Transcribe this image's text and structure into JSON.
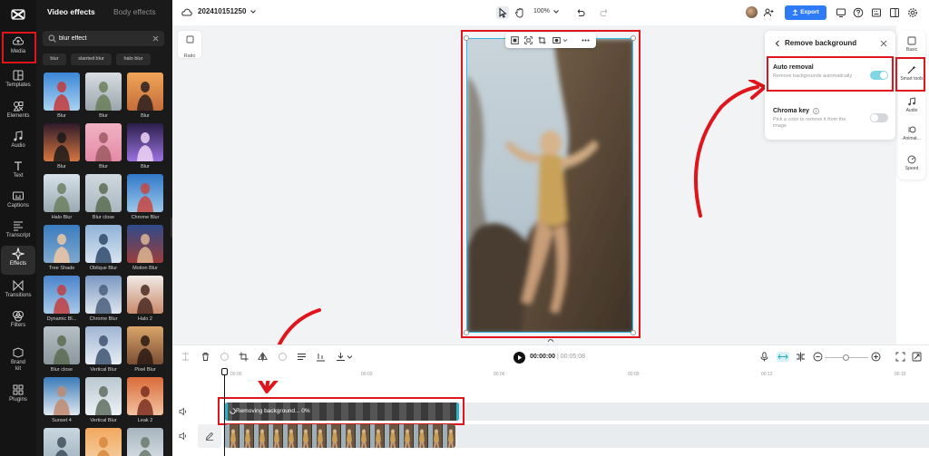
{
  "sidebar": {
    "items": [
      {
        "label": "Media",
        "icon": "cloud-upload-icon",
        "active": true
      },
      {
        "label": "Templates",
        "icon": "template-icon"
      },
      {
        "label": "Elements",
        "icon": "elements-icon"
      },
      {
        "label": "Audio",
        "icon": "music-note-icon"
      },
      {
        "label": "Text",
        "icon": "text-icon"
      },
      {
        "label": "Captions",
        "icon": "captions-icon"
      },
      {
        "label": "Transcript",
        "icon": "transcript-icon"
      },
      {
        "label": "Effects",
        "icon": "sparkle-icon",
        "active": true
      },
      {
        "label": "Transitions",
        "icon": "transitions-icon"
      },
      {
        "label": "Filters",
        "icon": "filters-icon"
      },
      {
        "label": "Brand kit",
        "icon": "brand-kit-icon"
      },
      {
        "label": "Plugins",
        "icon": "plugins-icon"
      }
    ]
  },
  "effects_panel": {
    "tabs": [
      "Video effects",
      "Body effects"
    ],
    "active_tab": "Video effects",
    "search": {
      "value": "blur effect",
      "placeholder": "Search"
    },
    "chips": [
      "blur",
      "slanted blur",
      "halo blur"
    ],
    "tiles": [
      {
        "label": "Blur"
      },
      {
        "label": "Blur"
      },
      {
        "label": "Blur"
      },
      {
        "label": "Blur"
      },
      {
        "label": "Blur"
      },
      {
        "label": "Blur"
      },
      {
        "label": "Halo Blur"
      },
      {
        "label": "Blur close"
      },
      {
        "label": "Chrome Blur"
      },
      {
        "label": "Tree Shade"
      },
      {
        "label": "Oblique Blur"
      },
      {
        "label": "Motion Blur"
      },
      {
        "label": "Dynamic Bl..."
      },
      {
        "label": "Chrome Blur"
      },
      {
        "label": "Halo 2"
      },
      {
        "label": "Blur close"
      },
      {
        "label": "Vertical Blur"
      },
      {
        "label": "Pixel Blur"
      },
      {
        "label": "Sunset 4"
      },
      {
        "label": "Vertical Blur"
      },
      {
        "label": "Leak 2"
      },
      {
        "label": ""
      },
      {
        "label": ""
      },
      {
        "label": ""
      }
    ]
  },
  "topbar": {
    "project_name": "202410151250",
    "zoom": "100%",
    "export_label": "Export"
  },
  "canvas": {
    "ratio_label": "Ratio"
  },
  "remove_bg": {
    "title": "Remove background",
    "auto": {
      "title": "Auto removal",
      "subtitle": "Remove backgrounds automatically",
      "enabled": true
    },
    "chroma": {
      "title": "Chroma key",
      "subtitle": "Pick a color to remove it from the image",
      "enabled": false
    }
  },
  "right_tools": [
    {
      "label": "Basic",
      "icon": "basic-icon"
    },
    {
      "label": "Smart tools",
      "icon": "magic-wand-icon"
    },
    {
      "label": "Audio",
      "icon": "audio-icon"
    },
    {
      "label": "Animat...",
      "icon": "animation-icon"
    },
    {
      "label": "Speed",
      "icon": "speed-icon"
    }
  ],
  "timeline": {
    "current_time": "00:00:00",
    "separator": "|",
    "total_time": "00:05:08",
    "ruler": [
      "00:00",
      "00:03",
      "00:06",
      "00:09",
      "00:12",
      "00:15"
    ],
    "clip_status": "Removing background... 0%"
  },
  "colors": {
    "accent_blue": "#2d7bf6",
    "highlight_red": "#e0141b",
    "toggle_on": "#6fd3e3",
    "dark_panel": "#1a1a1a"
  }
}
